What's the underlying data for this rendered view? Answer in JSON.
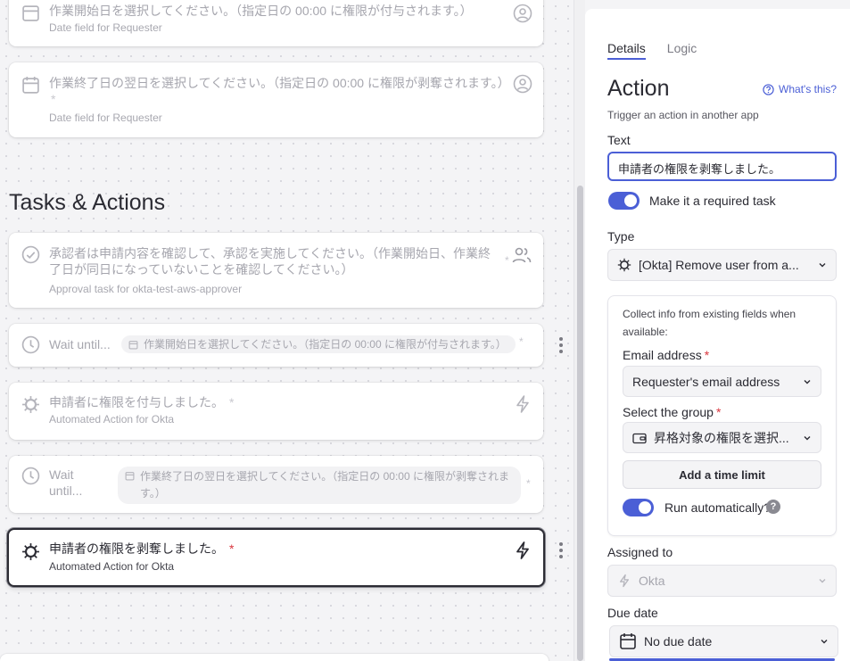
{
  "canvas": {
    "cards_top": [
      {
        "title": "作業開始日を選択してください。（指定日の 00:00 に権限が付与されます。）",
        "subtitle": "Date field for Requester",
        "required": "*"
      },
      {
        "title": "作業終了日の翌日を選択してください。（指定日の 00:00 に権限が剥奪されます。）",
        "subtitle": "Date field for Requester",
        "required": "*"
      }
    ],
    "section_title": "Tasks & Actions",
    "approval": {
      "title": "承認者は申請内容を確認して、承認を実施してください。（作業開始日、作業終了日が同日になっていないことを確認してください。）",
      "subtitle": "Approval task for okta-test-aws-approver",
      "required": "*"
    },
    "wait1": {
      "label": "Wait until...",
      "pill": "作業開始日を選択してください。（指定日の 00:00 に権限が付与されます。）",
      "required": "*"
    },
    "grant": {
      "title": "申請者に権限を付与しました。",
      "subtitle": "Automated Action for Okta",
      "required": "*"
    },
    "wait2": {
      "label": "Wait until...",
      "pill": "作業終了日の翌日を選択してください。（指定日の 00:00 に権限が剥奪されます。）",
      "required": "*"
    },
    "revoke": {
      "title": "申請者の権限を剥奪しました。",
      "subtitle": "Automated Action for Okta",
      "required": "*"
    }
  },
  "panel": {
    "tabs": [
      "Details",
      "Logic"
    ],
    "title": "Action",
    "whats_this": "What's this?",
    "description": "Trigger an action in another app",
    "text_label": "Text",
    "text_value": "申請者の権限を剥奪しました。",
    "required_toggle_label": "Make it a required task",
    "type_label": "Type",
    "type_value": "[Okta] Remove user from a...",
    "collect_desc": "Collect info from existing fields when available:",
    "email_label": "Email address",
    "email_value": "Requester's email address",
    "group_label": "Select the group",
    "group_value": "昇格対象の権限を選択...",
    "required_star": "*",
    "time_limit_button": "Add a time limit",
    "run_auto_label": "Run automatically?",
    "help_glyph": "?",
    "assigned_label": "Assigned to",
    "assigned_value": "Okta",
    "due_label": "Due date",
    "due_value": "No due date"
  },
  "colors": {
    "accent": "#4b5fd6",
    "required": "#d9363e"
  }
}
